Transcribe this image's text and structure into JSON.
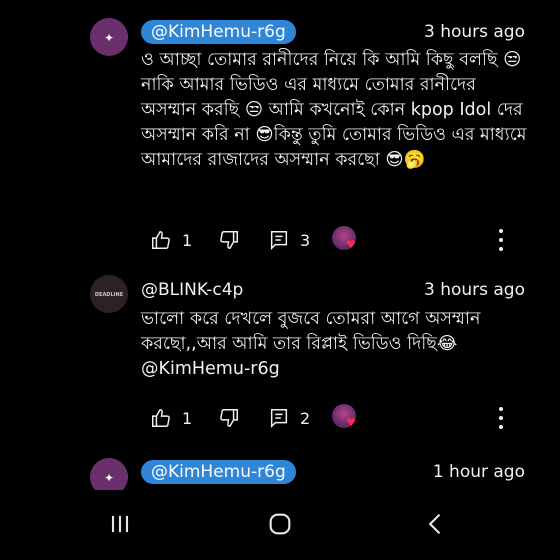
{
  "comments": [
    {
      "author": "@KimHemu-r6g",
      "time": "3 hours ago",
      "avatar_icon": "kim-hemu-avatar",
      "author_highlighted": true,
      "text": "ও আচ্ছা তোমার রানীদের নিয়ে কি আমি কিছু বলছি 😒নাকি আমার ভিডিও এর মাধ্যমে তোমার রানীদের অসম্মান করছি 😒 আমি কখনোই কোন kpop Idol দের অসম্মান করি না 😎কিন্তু তুমি তোমার ভিডিও এর মাধ্যমে আমাদের রাজাদের অসম্মান করছো 😎🥱",
      "likes": "1",
      "replies": "3"
    },
    {
      "author": "@BLINK-c4p",
      "time": "3 hours ago",
      "avatar_icon": "blink-avatar",
      "avatar_text": "DEADLINE",
      "author_highlighted": false,
      "text": "ভালো করে দেখলে বুজবে তোমরা আগে অসম্মান করছো,,আর আমি তার রিপ্লাই ভিডিও দিছি😂 @KimHemu-r6g",
      "likes": "1",
      "replies": "2"
    },
    {
      "author": "@KimHemu-r6g",
      "time": "1 hour ago",
      "avatar_icon": "kim-hemu-avatar",
      "author_highlighted": true
    }
  ],
  "icons": {
    "like": "thumb-up-icon",
    "dislike": "thumb-down-icon",
    "reply": "reply-comment-icon",
    "more": "more-vert-icon",
    "creator_heart": "heart-icon"
  },
  "colors": {
    "background": "#000000",
    "chip": "#2f86d6",
    "text": "#f1f1f1",
    "heart": "#ff2a4d"
  },
  "navbar": {
    "recents": "recents-icon",
    "home": "home-icon",
    "back": "back-icon"
  }
}
